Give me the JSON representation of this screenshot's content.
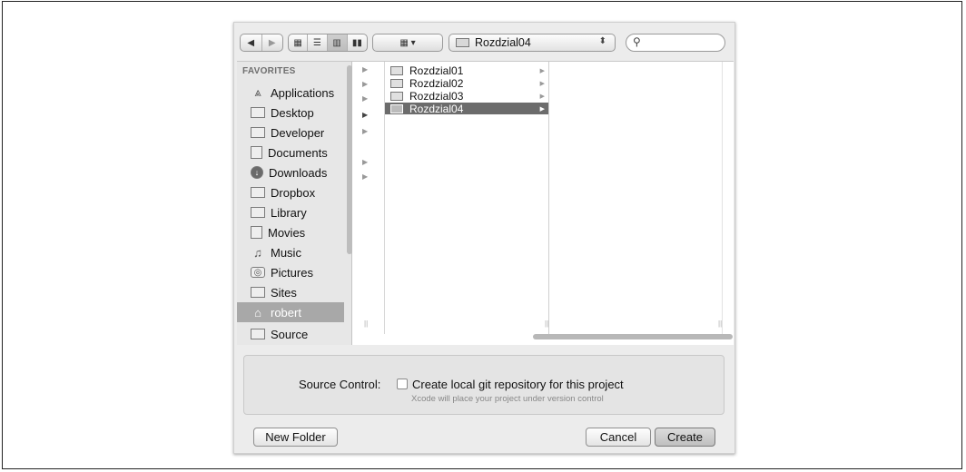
{
  "toolbar": {
    "back_icon": "back-arrow-icon",
    "forward_icon": "forward-arrow-icon",
    "views": [
      "icon-view-icon",
      "list-view-icon",
      "column-view-icon",
      "coverflow-view-icon"
    ],
    "arrange_icon": "arrange-menu-icon",
    "path_popup_value": "Rozdzial04",
    "search_placeholder": ""
  },
  "sidebar": {
    "header": "FAVORITES",
    "items": [
      {
        "label": "Applications",
        "icon": "applications-icon"
      },
      {
        "label": "Desktop",
        "icon": "desktop-icon"
      },
      {
        "label": "Developer",
        "icon": "folder-icon"
      },
      {
        "label": "Documents",
        "icon": "documents-icon"
      },
      {
        "label": "Downloads",
        "icon": "downloads-icon"
      },
      {
        "label": "Dropbox",
        "icon": "folder-icon"
      },
      {
        "label": "Library",
        "icon": "folder-icon"
      },
      {
        "label": "Movies",
        "icon": "movies-icon"
      },
      {
        "label": "Music",
        "icon": "music-icon"
      },
      {
        "label": "Pictures",
        "icon": "pictures-icon"
      },
      {
        "label": "Sites",
        "icon": "folder-icon"
      },
      {
        "label": "robert",
        "icon": "home-icon",
        "selected": true
      },
      {
        "label": "Source",
        "icon": "folder-icon"
      }
    ]
  },
  "columns": {
    "folders": [
      {
        "label": "Rozdzial01"
      },
      {
        "label": "Rozdzial02"
      },
      {
        "label": "Rozdzial03"
      },
      {
        "label": "Rozdzial04",
        "selected": true
      }
    ]
  },
  "options": {
    "source_control_label": "Source Control:",
    "checkbox_label": "Create local git repository for this project",
    "checkbox_checked": false,
    "hint": "Xcode will place your project under version control"
  },
  "buttons": {
    "new_folder": "New Folder",
    "cancel": "Cancel",
    "create": "Create"
  },
  "colors": {
    "selection": "#6c6c6c",
    "sidebar_selection": "#a8a8a8",
    "dialog_bg": "#ececec"
  }
}
